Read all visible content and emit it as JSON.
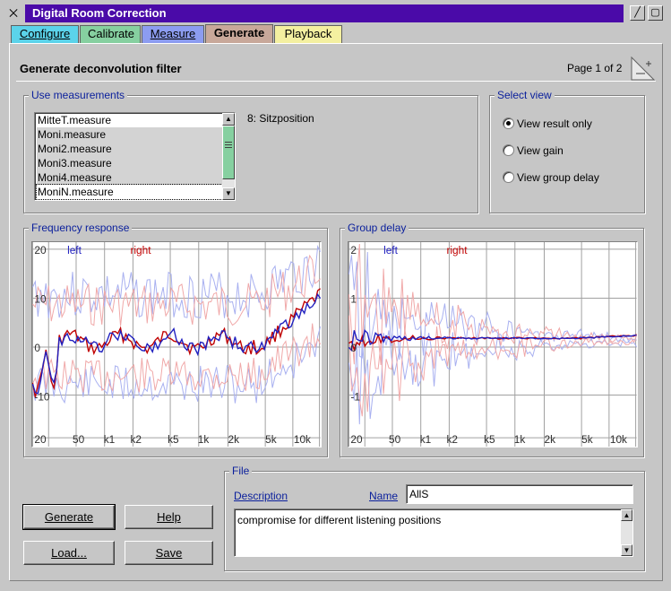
{
  "window": {
    "title": "Digital Room Correction"
  },
  "tabs": [
    {
      "label": "Configure",
      "color": "#5bd3ea"
    },
    {
      "label": "Calibrate",
      "color": "#86d0a0"
    },
    {
      "label": "Measure",
      "color": "#8c9cf0"
    },
    {
      "label": "Generate",
      "color": "#c8a89a"
    },
    {
      "label": "Playback",
      "color": "#f4f0a0"
    }
  ],
  "header": {
    "title": "Generate deconvolution filter",
    "page": "Page 1 of 2"
  },
  "measurements": {
    "legend": "Use measurements",
    "items": [
      {
        "label": "MitteT.measure",
        "selected": false
      },
      {
        "label": "Moni.measure",
        "selected": true
      },
      {
        "label": "Moni2.measure",
        "selected": true
      },
      {
        "label": "Moni3.measure",
        "selected": true
      },
      {
        "label": "Moni4.measure",
        "selected": true
      },
      {
        "label": "MoniN.measure",
        "selected": false
      }
    ],
    "info": "8: Sitzposition"
  },
  "select_view": {
    "legend": "Select view",
    "options": [
      {
        "label": "View result only",
        "checked": true
      },
      {
        "label": "View gain",
        "checked": false
      },
      {
        "label": "View group delay",
        "checked": false
      }
    ]
  },
  "frequency_plot": {
    "legend": "Frequency response",
    "y_ticks": [
      "20",
      "10",
      "0",
      "-10"
    ],
    "x_ticks": [
      "20",
      "50",
      "k1",
      "k2",
      "k5",
      "1k",
      "2k",
      "5k",
      "10k"
    ],
    "series": [
      {
        "name": "left",
        "color": "#2020c0"
      },
      {
        "name": "right",
        "color": "#c00000"
      }
    ]
  },
  "delay_plot": {
    "legend": "Group delay",
    "y_ticks": [
      "2",
      "1",
      "0",
      "-1"
    ],
    "x_ticks": [
      "20",
      "50",
      "k1",
      "k2",
      "k5",
      "1k",
      "2k",
      "5k",
      "10k"
    ],
    "series": [
      {
        "name": "left",
        "color": "#2020c0"
      },
      {
        "name": "right",
        "color": "#c00000"
      }
    ]
  },
  "buttons": {
    "generate": "Generate",
    "help": "Help",
    "load": "Load...",
    "save": "Save"
  },
  "file": {
    "legend": "File",
    "description_label": "Description",
    "name_label": "Name",
    "name_value": "AllS",
    "description_value": "compromise for different listening positions"
  }
}
